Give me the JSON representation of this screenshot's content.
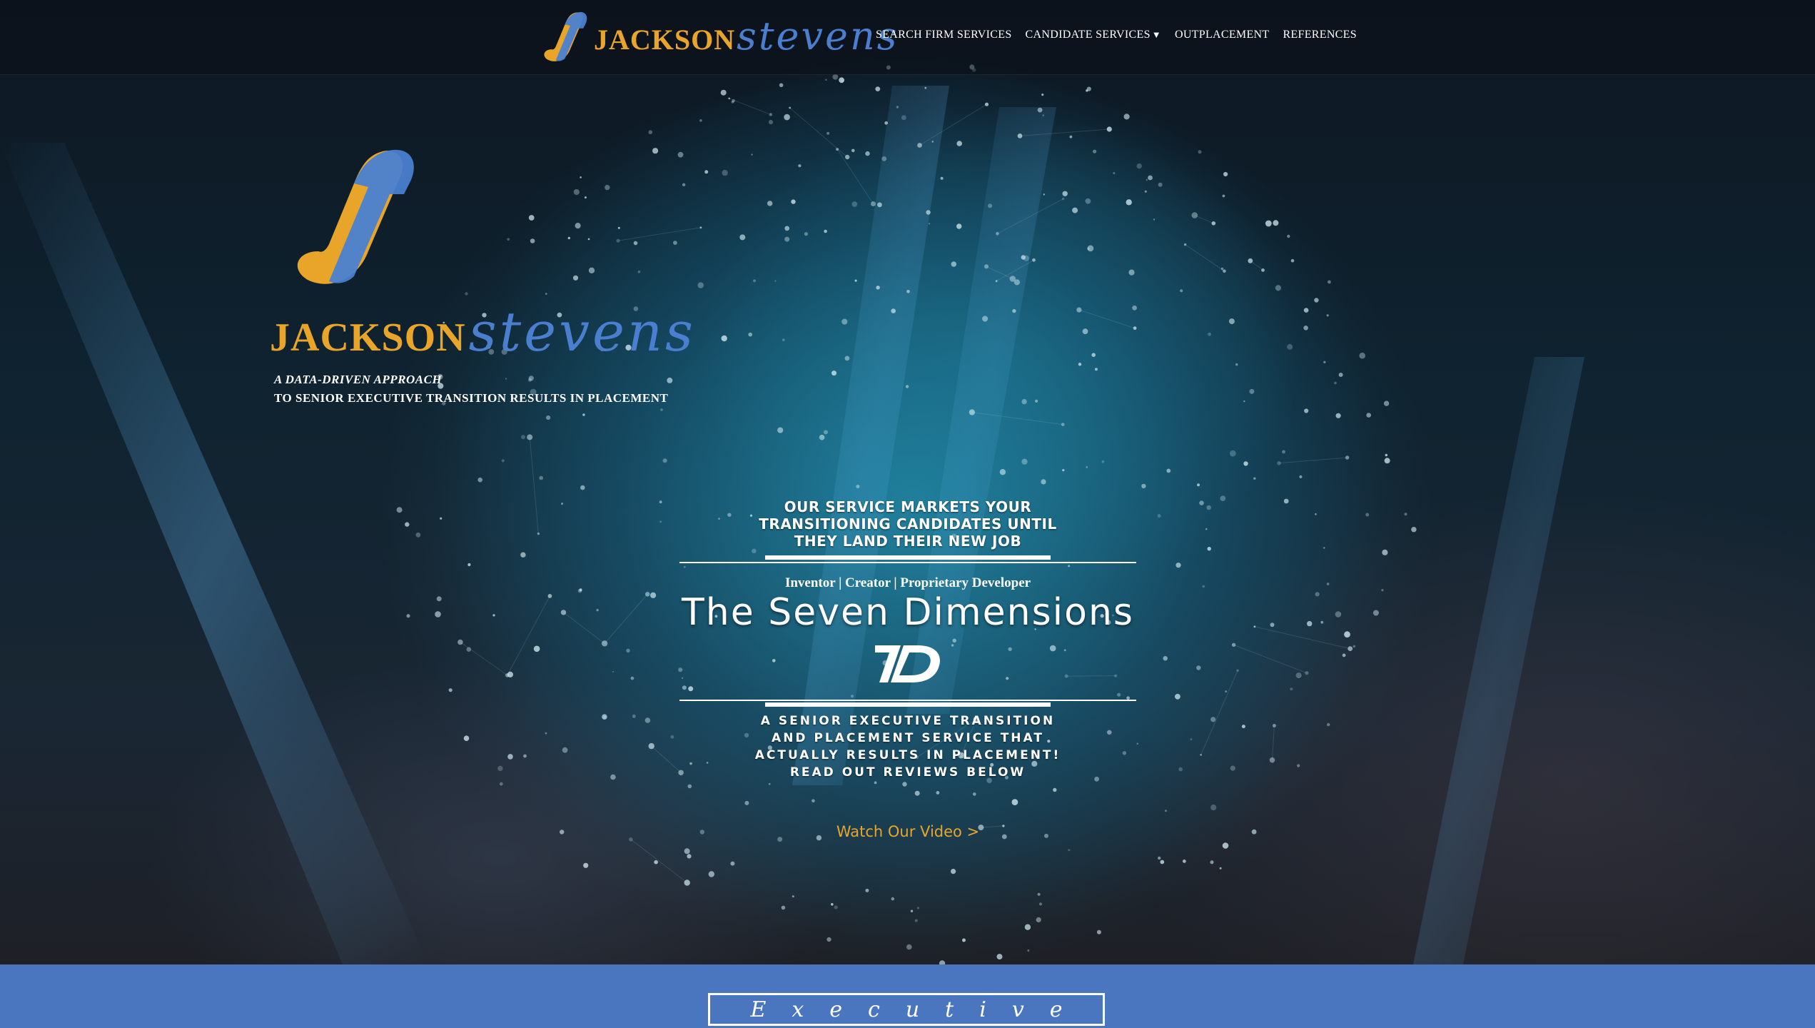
{
  "brand": {
    "name_part1": "JACKSON",
    "name_part2": "stevens",
    "colors": {
      "gold": "#e9a529",
      "blue": "#4a7fd0"
    }
  },
  "nav": {
    "items": [
      {
        "label": "SEARCH FIRM SERVICES"
      },
      {
        "label": "CANDIDATE SERVICES",
        "caret": "▼"
      },
      {
        "label": "OUTPLACEMENT"
      },
      {
        "label": "REFERENCES"
      }
    ]
  },
  "hero": {
    "tagline_line1": "A DATA-DRIVEN APPROACH",
    "tagline_line2": "TO SENIOR EXECUTIVE TRANSITION RESULTS IN PLACEMENT",
    "service_heading": [
      "OUR SERVICE MARKETS YOUR",
      "TRANSITIONING CANDIDATES UNTIL",
      "THEY LAND THEIR NEW JOB"
    ],
    "roles": "Inventor | Creator | Proprietary Developer",
    "product_name": "The Seven Dimensions",
    "senior_text": [
      "A SENIOR EXECUTIVE TRANSITION",
      "AND PLACEMENT SERVICE THAT",
      "ACTUALLY RESULTS IN PLACEMENT!",
      "READ OUT REVIEWS BELOW"
    ],
    "watch_video": "Watch Our Video >"
  },
  "section": {
    "executive_label": "Executive"
  },
  "icons": [
    "js-logo-icon",
    "seven-dimensions-logo-icon",
    "dropdown-caret-icon"
  ]
}
